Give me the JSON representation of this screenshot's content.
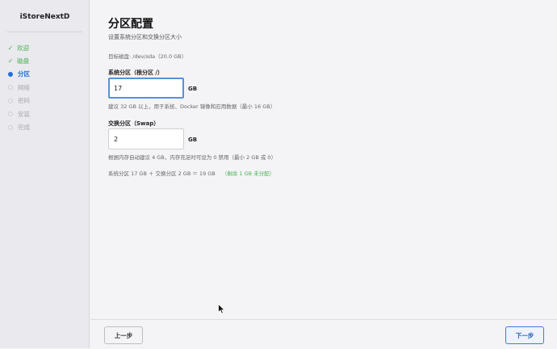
{
  "sidebar": {
    "brand": "iStoreNextD",
    "steps": [
      {
        "label": "欢迎",
        "state": "done"
      },
      {
        "label": "磁盘",
        "state": "done"
      },
      {
        "label": "分区",
        "state": "active"
      },
      {
        "label": "网络",
        "state": "pending"
      },
      {
        "label": "密码",
        "state": "pending"
      },
      {
        "label": "安装",
        "state": "pending"
      },
      {
        "label": "完成",
        "state": "pending"
      }
    ]
  },
  "main": {
    "title": "分区配置",
    "subtitle": "设置系统分区和交换分区大小",
    "target_disk": "目标磁盘: /dev/sda（20.0 GB）",
    "system_partition": {
      "label": "系统分区（根分区 /）",
      "value": "17",
      "unit": "GB",
      "hint": "建议 32 GB 以上，用于系统、Docker 镜像和应用数据（最小 16 GB）"
    },
    "swap_partition": {
      "label": "交换分区（Swap）",
      "value": "2",
      "unit": "GB",
      "hint": "根据内存自动建议 4 GB，内存充足时可设为 0 禁用（最小 2 GB 或 0）"
    },
    "summary": "系统分区 17 GB ＋ 交换分区 2 GB ＝ 19 GB",
    "summary_remaining": "（剩余 1 GB 未分配）"
  },
  "footer": {
    "prev_label": "上一步",
    "next_label": "下一步"
  },
  "colors": {
    "accent": "#1f6fd6",
    "done": "#4caf50",
    "focus_border": "#5b8fd9"
  }
}
